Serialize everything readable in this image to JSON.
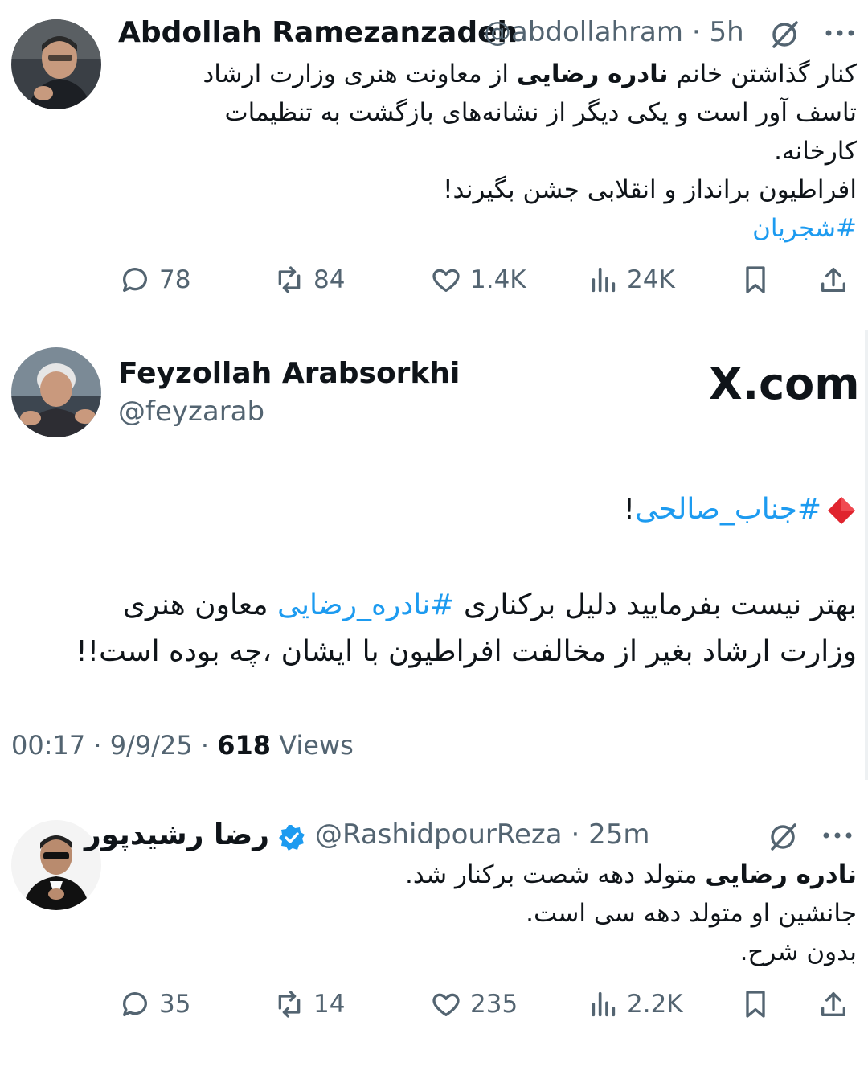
{
  "tweet1": {
    "author_name": "Abdollah Ramezanzadeh",
    "author_handle": "@abdollahram",
    "sep": "·",
    "time": "5h",
    "lines": [
      {
        "before": "کنار گذاشتن خانم ",
        "bold": "نادره رضایی",
        "after": " از معاونت هنری وزارت ارشاد"
      },
      {
        "text": "تاسف آور است و یکی دیگر از نشانه‌های بازگشت به تنظیمات"
      },
      {
        "text": "کارخانه."
      },
      {
        "text": "افراطیون برانداز و انقلابی جشن بگیرند!"
      }
    ],
    "hashtag": "#شجریان",
    "replies": "78",
    "retweets": "84",
    "likes": "1.4K",
    "views": "24K",
    "colors": {
      "avatar_bg": "#3a3f45",
      "avatar_face": "#c79a7e"
    }
  },
  "tweet2": {
    "author_name": "Feyzollah Arabsorkhi",
    "author_handle": "@feyzarab",
    "brand": "X.com",
    "diamond_color": "#e0242e",
    "hashtag_line": {
      "hashtag": "#جناب_صالحی",
      "after": "!"
    },
    "line1": {
      "before": "بهتر نیست بفرمایید دلیل برکناری ",
      "hashtag": "#نادره_رضایی",
      "after": " معاون هنری"
    },
    "line2": "وزارت ارشاد بغیر از مخالفت افراطیون با ایشان ،چه بوده است!!",
    "meta": {
      "time": "00:17",
      "sep": "·",
      "date": "9/9/25",
      "views_count": "618",
      "views_label": "Views"
    }
  },
  "tweet3": {
    "author_name": "رضا رشیدپور",
    "author_handle": "@RashidpourReza",
    "sep": "·",
    "time": "25m",
    "verified_color": "#1d9bf0",
    "lines": [
      {
        "bold": "نادره رضایی",
        "after": " متولد دهه شصت برکنار شد."
      },
      {
        "text": "جانشین او متولد دهه سی است."
      },
      {
        "text": "بدون شرح."
      }
    ],
    "replies": "35",
    "retweets": "14",
    "likes": "235",
    "views": "2.2K"
  }
}
